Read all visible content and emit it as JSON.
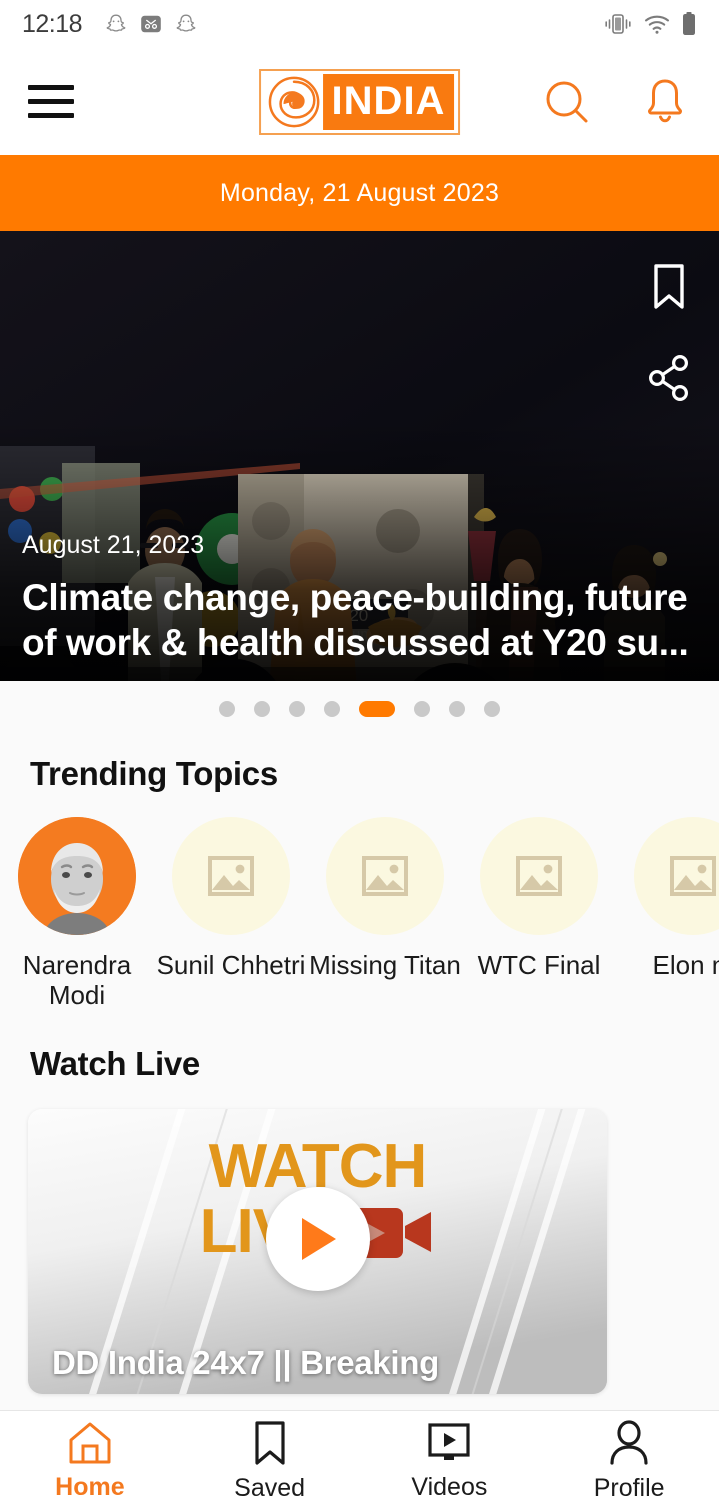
{
  "status_bar": {
    "time": "12:18",
    "left_icons": [
      "snapchat-icon",
      "snapchat-cut-icon",
      "snapchat-icon"
    ],
    "right_icons": [
      "vibrate-icon",
      "wifi-icon",
      "battery-icon"
    ]
  },
  "header": {
    "menu_icon": "hamburger-menu-icon",
    "logo_text": "INDIA",
    "logo_mark": "dd-swirl-icon",
    "search_icon": "search-icon",
    "notification_icon": "bell-icon",
    "accent_color": "#F4791F"
  },
  "date_banner": {
    "text": "Monday, 21 August 2023",
    "background_color": "#FF7A00"
  },
  "hero": {
    "date": "August 21, 2023",
    "title": "Climate change, peace-building, future of work & health discussed at Y20 su...",
    "bookmark_icon": "bookmark-icon",
    "share_icon": "share-icon"
  },
  "carousel": {
    "total_dots": 8,
    "active_index": 4,
    "active_color": "#FF7A00",
    "inactive_color": "#C9C9C9"
  },
  "trending": {
    "title": "Trending Topics",
    "items": [
      {
        "label": "Narendra Modi",
        "image": "portrait-photo"
      },
      {
        "label": "Sunil Chhetri",
        "image": "image-placeholder-icon"
      },
      {
        "label": "Missing Titan",
        "image": "image-placeholder-icon"
      },
      {
        "label": "WTC Final",
        "image": "image-placeholder-icon"
      },
      {
        "label": "Elon m",
        "image": "image-placeholder-icon"
      }
    ]
  },
  "watch_live": {
    "title": "Watch Live",
    "card": {
      "watermark_line1": "WATCH",
      "watermark_line2": "LIVE",
      "caption": "DD India 24x7 || Breaking",
      "play_icon": "play-icon",
      "camera_icon": "video-camera-icon"
    }
  },
  "bottom_nav": {
    "active_index": 0,
    "items": [
      {
        "label": "Home",
        "icon": "home-icon"
      },
      {
        "label": "Saved",
        "icon": "bookmark-icon"
      },
      {
        "label": "Videos",
        "icon": "video-player-icon"
      },
      {
        "label": "Profile",
        "icon": "person-icon"
      }
    ]
  }
}
